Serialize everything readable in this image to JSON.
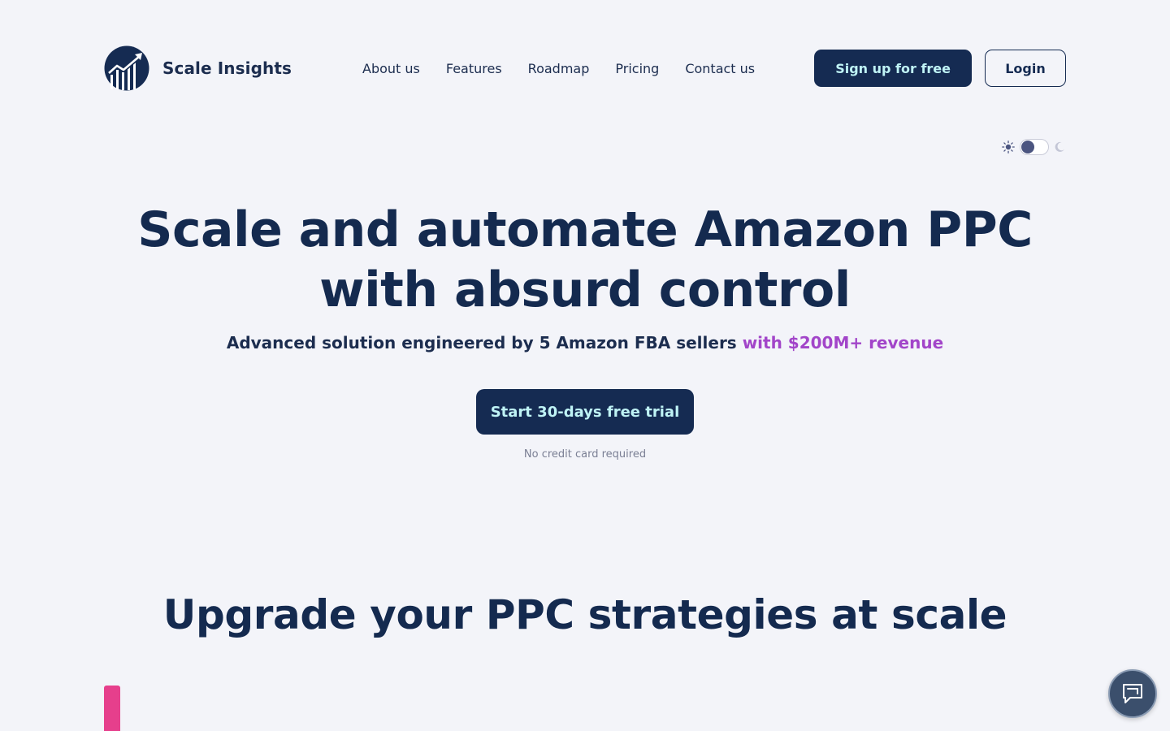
{
  "brand": {
    "name": "Scale Insights",
    "logo_icon": "growth-chart-logo",
    "primary_color": "#152b52",
    "accent_color": "#a245c9"
  },
  "nav": {
    "items": [
      {
        "label": "About us"
      },
      {
        "label": "Features"
      },
      {
        "label": "Roadmap"
      },
      {
        "label": "Pricing"
      },
      {
        "label": "Contact us"
      }
    ]
  },
  "actions": {
    "signup_label": "Sign up for free",
    "login_label": "Login"
  },
  "theme_toggle": {
    "mode": "light",
    "left_icon": "sun-icon",
    "right_icon": "moon-icon"
  },
  "hero": {
    "title_line1": "Scale and automate Amazon PPC",
    "title_line2": "with absurd control",
    "subtitle_main": "Advanced solution engineered by 5 Amazon FBA sellers",
    "subtitle_accent": "with $200M+ revenue",
    "cta_label": "Start 30-days free trial",
    "cta_note": "No credit card required"
  },
  "section": {
    "title": "Upgrade your PPC strategies at scale"
  },
  "chat": {
    "icon": "chat-icon"
  }
}
